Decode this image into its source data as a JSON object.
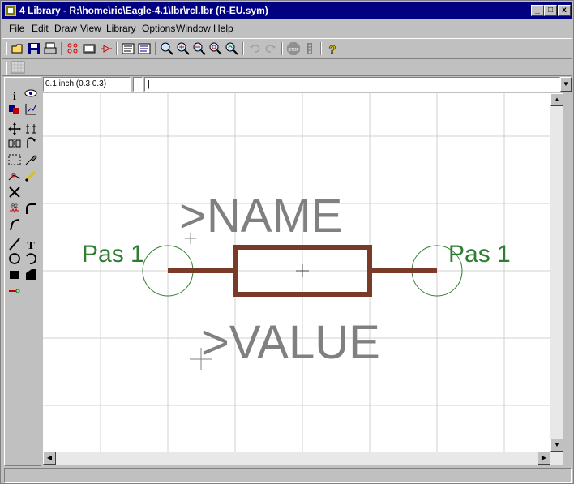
{
  "window": {
    "title": "4 Library - R:\\home\\ric\\Eagle-4.1\\lbr\\rcl.lbr (R-EU.sym)",
    "minimize": "_",
    "maximize": "□",
    "close": "x"
  },
  "menu": {
    "file": "File",
    "edit": "Edit",
    "draw": "Draw",
    "view": "View",
    "library": "Library",
    "options": "Options",
    "window": "Window",
    "help": "Help"
  },
  "command": {
    "grid_text": "0.1 inch (0.3 0.3)",
    "input_value": "|"
  },
  "canvas": {
    "name_text": ">NAME",
    "value_text": ">VALUE",
    "pin_left_label": "Pas 1",
    "pin_right_label": "Pas 1"
  },
  "status": {
    "text": ""
  },
  "colors": {
    "titlebar": "#000080",
    "wire": "#7a3a28",
    "pin_label": "#2e7d32",
    "text_placeholder": "#808080",
    "grid": "#d0d0d0"
  },
  "icons": {
    "toolbar": [
      "open-icon",
      "save-icon",
      "print-icon",
      "cam-icon",
      "script-icon",
      "ulp-icon",
      "zoom-fit-icon",
      "zoom-in-icon",
      "zoom-out-icon",
      "zoom-select-icon",
      "redraw-icon",
      "undo-icon",
      "redo-icon",
      "stop-icon",
      "go-icon",
      "help-icon"
    ],
    "leftpanel": [
      "info-icon",
      "show-icon",
      "display-icon",
      "mark-icon",
      "move-icon",
      "copy-icon",
      "mirror-icon",
      "rotate-icon",
      "group-icon",
      "change-icon",
      "split-icon",
      "name-icon",
      "delete-icon",
      "value-icon",
      "smash-icon",
      "miter-icon",
      "wire-icon",
      "text-icon",
      "circle-icon",
      "arc-icon",
      "rect-icon",
      "polygon-icon",
      "pin-icon"
    ]
  }
}
